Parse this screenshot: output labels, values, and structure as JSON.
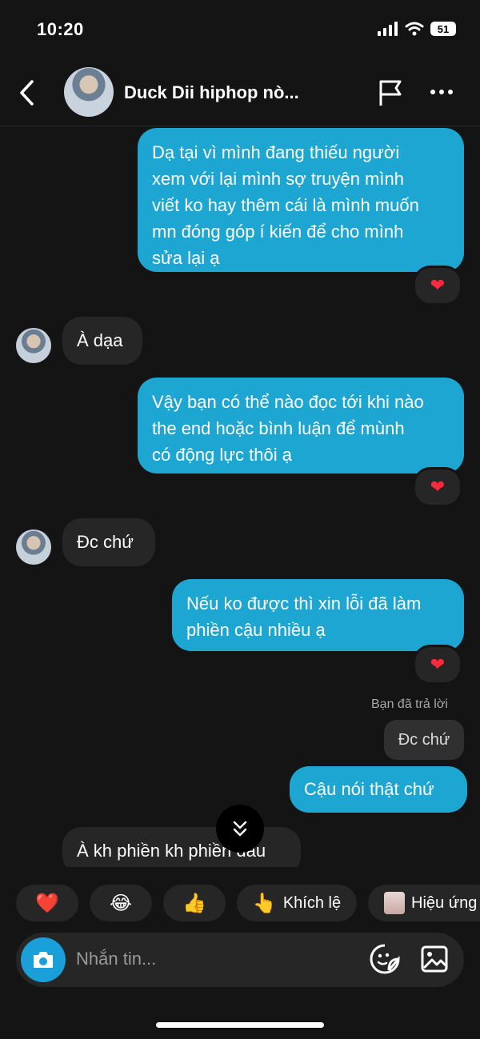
{
  "status_bar": {
    "time": "10:20",
    "battery": "51"
  },
  "header": {
    "contact_name": "Duck Dii hiphop nò..."
  },
  "messages": {
    "m1": {
      "text_lines": [
        "Dạ tại vì mình đang thiếu người",
        "xem với lại mình sợ truyện mình",
        "viết ko hay thêm cái là mình muốn",
        "mn đóng góp í kiến để cho mình",
        "sửa lại ạ"
      ],
      "reaction": "❤"
    },
    "m2": {
      "text": "À dạa"
    },
    "m3": {
      "text_lines": [
        "Vậy bạn có thể nào đọc tới khi nào",
        "the end hoặc bình luận để mùnh",
        "có động lực thôi ạ"
      ],
      "reaction": "❤"
    },
    "m4": {
      "text": "Đc chứ"
    },
    "m5": {
      "text_lines": [
        "Nếu ko được thì xin lỗi đã làm",
        "phiền cậu nhiều ạ"
      ],
      "reaction": "❤"
    },
    "reply_label": "Bạn đã trả lời",
    "reply_quote": "Đc chứ",
    "m6": {
      "text": "Cậu nói thật chứ"
    },
    "m7": {
      "text": "À kh phiền kh phiền đâu"
    }
  },
  "quick_reactions": [
    {
      "emoji": "❤️",
      "label": ""
    },
    {
      "emoji": "😂",
      "label": ""
    },
    {
      "emoji": "👍",
      "label": ""
    },
    {
      "emoji": "👆",
      "label": "Khích lệ"
    },
    {
      "emoji": "",
      "label": "Hiệu ứng"
    }
  ],
  "composer": {
    "placeholder": "Nhắn tin..."
  },
  "colors": {
    "outgoing_bubble": "#1ea6d2",
    "incoming_bubble": "#262626",
    "background": "#141414",
    "camera_button": "#1a9fd9"
  }
}
